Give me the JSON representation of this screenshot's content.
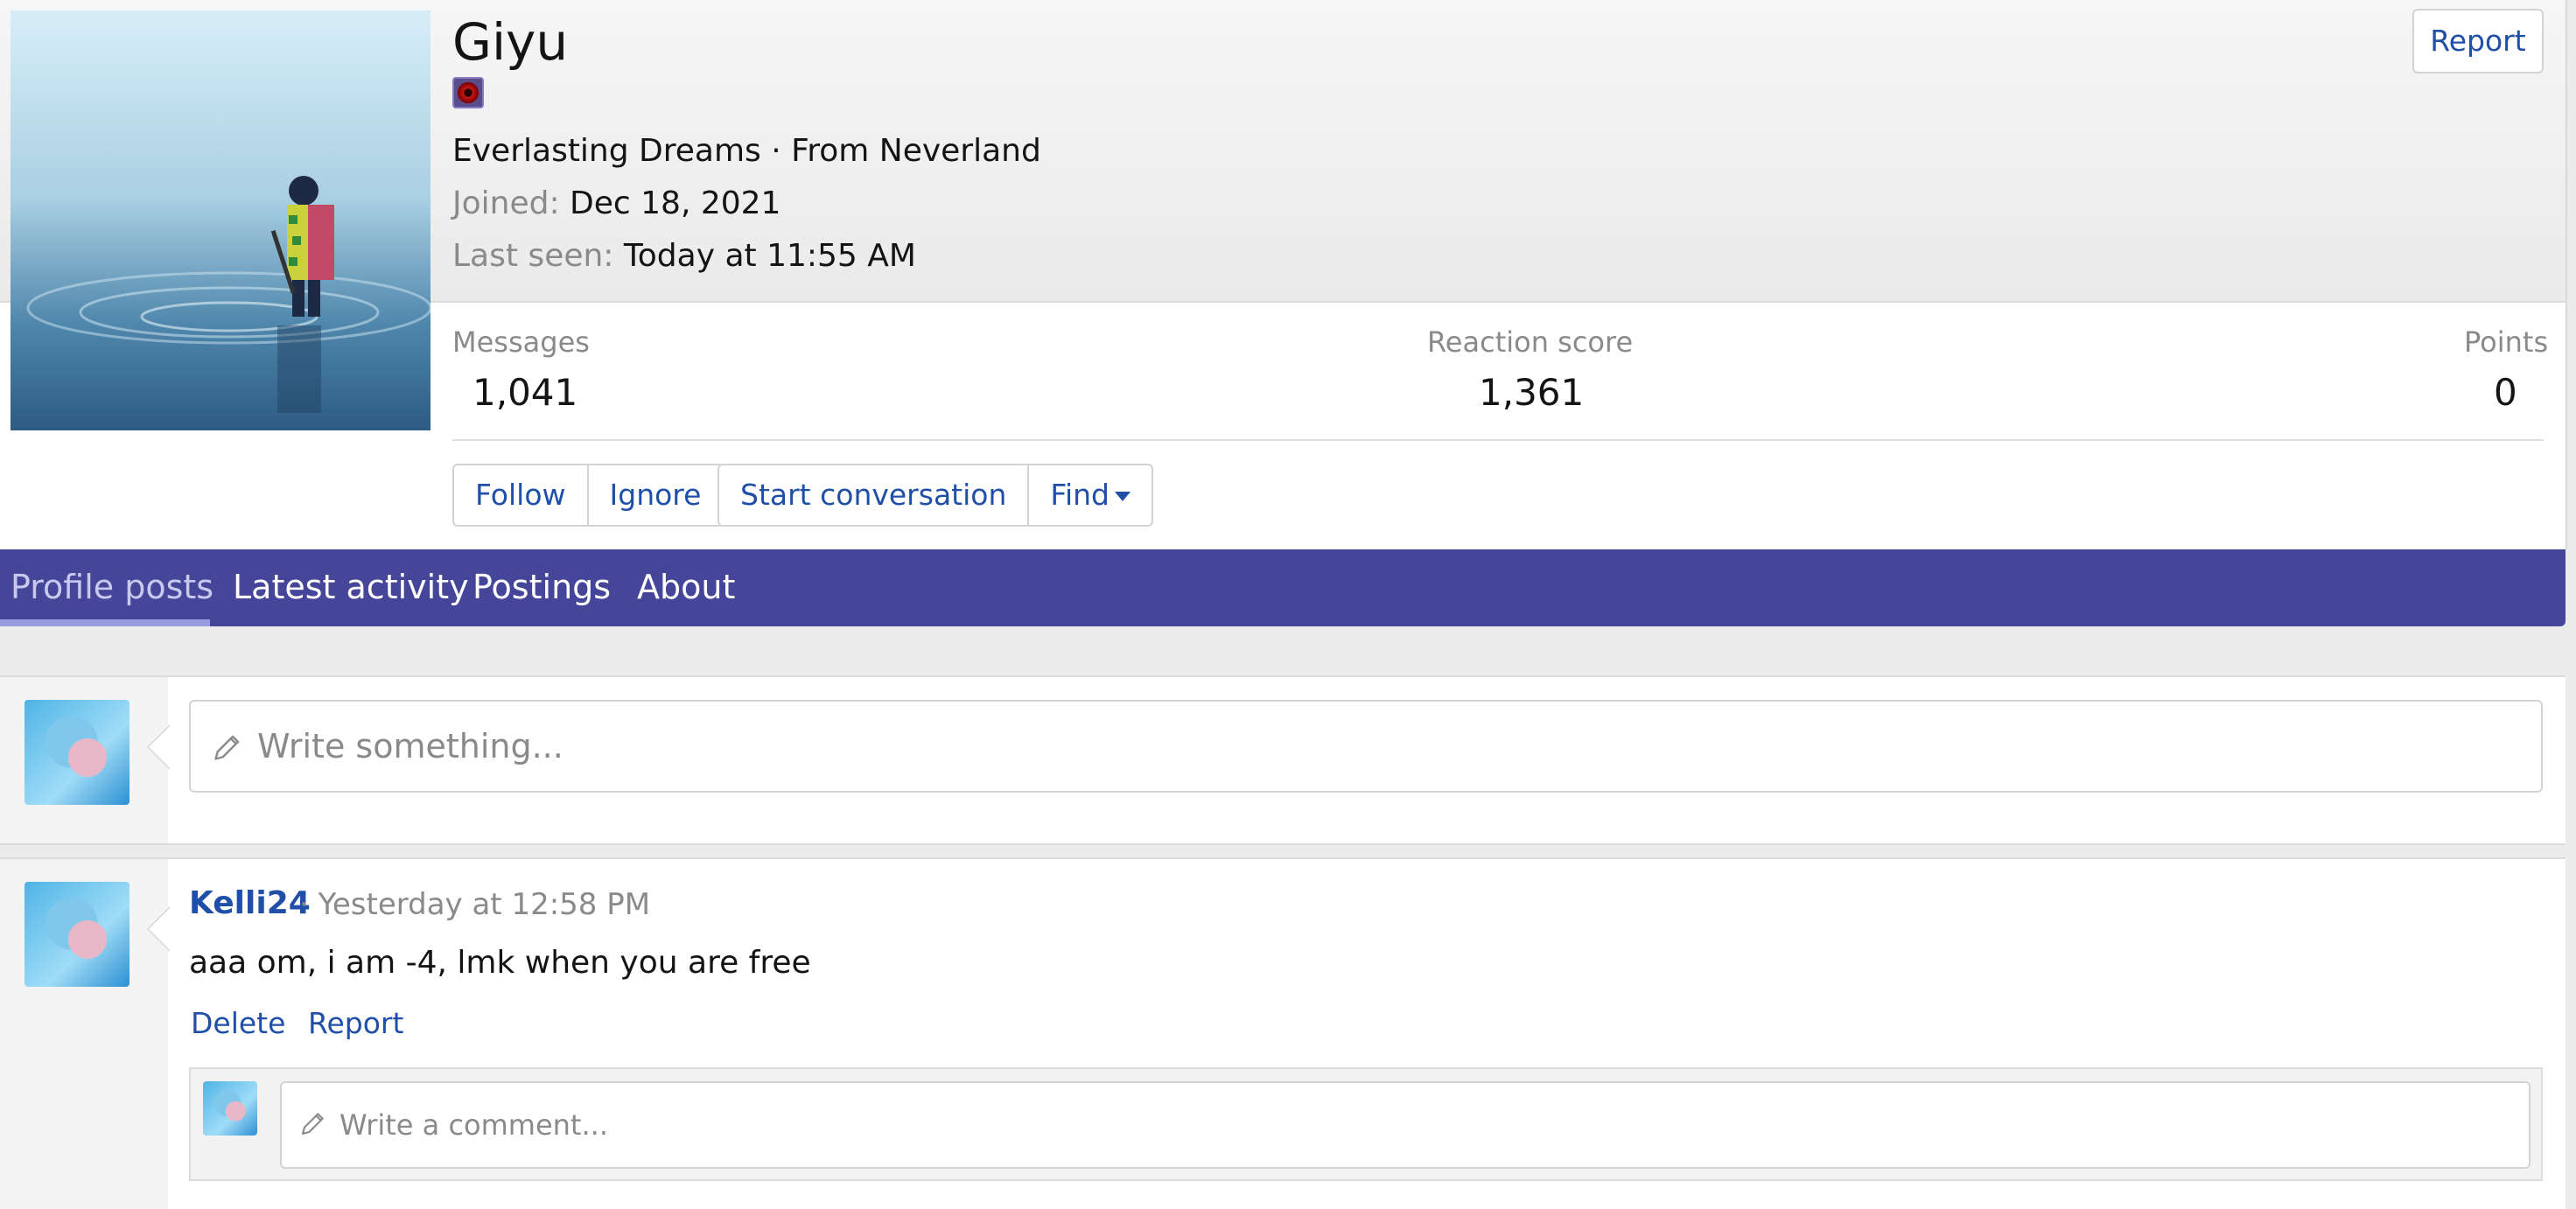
{
  "profile": {
    "username": "Giyu",
    "tagline": "Everlasting Dreams · From Neverland",
    "joined_label": "Joined:",
    "joined_value": "Dec 18, 2021",
    "last_seen_label": "Last seen:",
    "last_seen_value": "Today at 11:55 AM",
    "report_label": "Report"
  },
  "stats": {
    "messages_label": "Messages",
    "messages_value": "1,041",
    "reaction_label": "Reaction score",
    "reaction_value": "1,361",
    "points_label": "Points",
    "points_value": "0"
  },
  "actions": {
    "follow": "Follow",
    "ignore": "Ignore",
    "start_conversation": "Start conversation",
    "find": "Find"
  },
  "tabs": [
    {
      "label": "Profile posts",
      "active": true
    },
    {
      "label": "Latest activity",
      "active": false
    },
    {
      "label": "Postings",
      "active": false
    },
    {
      "label": "About",
      "active": false
    }
  ],
  "composer": {
    "placeholder": "Write something..."
  },
  "post": {
    "author": "Kelli24",
    "meta": "· Yesterday at 12:58 PM",
    "body": "aaa om, i am -4, lmk when you are free",
    "delete_label": "Delete",
    "report_label": "Report",
    "comment_placeholder": "Write a comment..."
  },
  "colors": {
    "accent": "#1f4fa8",
    "tab_bar": "#454599"
  }
}
